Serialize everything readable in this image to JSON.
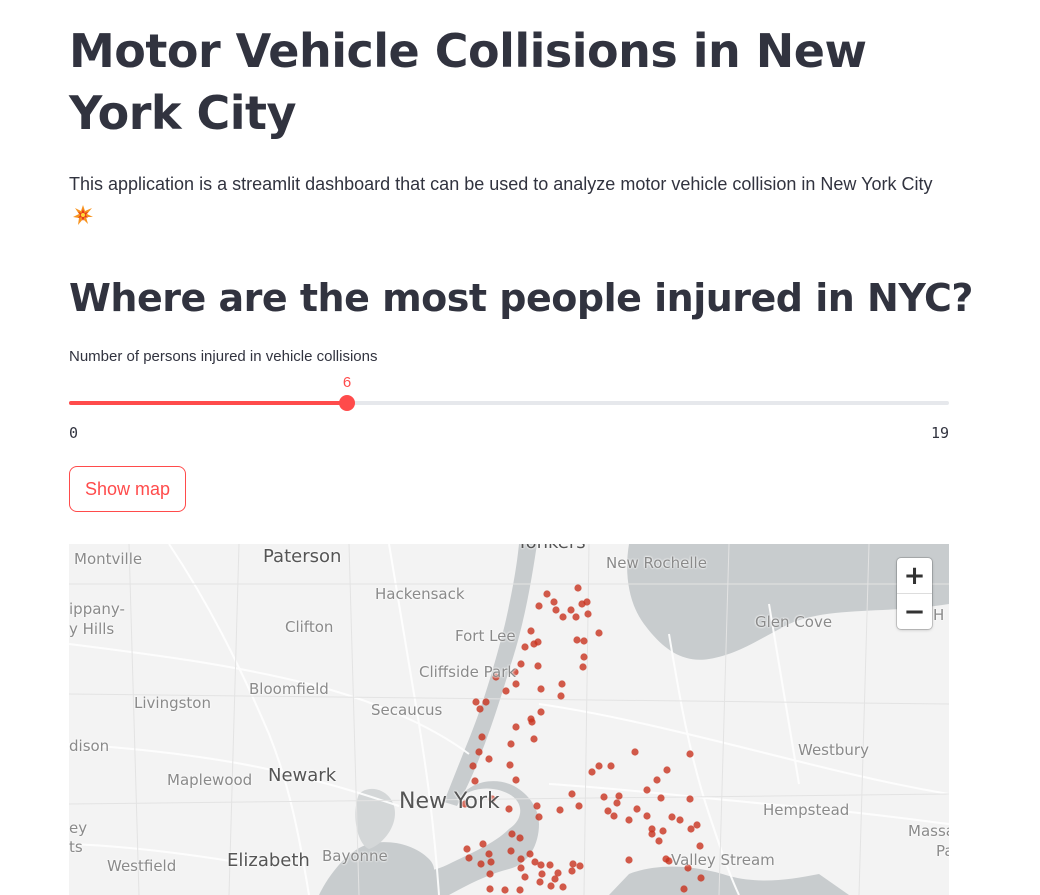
{
  "title": "Motor Vehicle Collisions in New York City",
  "intro": "This application is a streamlit dashboard that can be used to analyze motor vehicle collision in New York City",
  "section_heading": "Where are the most people injured in NYC?",
  "slider": {
    "label": "Number of persons injured in vehicle collisions",
    "min": 0,
    "max": 19,
    "value": 6,
    "min_label": "0",
    "max_label": "19",
    "value_label": "6"
  },
  "show_map_button": "Show map",
  "map": {
    "zoom_in": "+",
    "zoom_out": "−",
    "places": [
      {
        "name": "Montville",
        "size": "normal"
      },
      {
        "name": "Paterson",
        "size": "big"
      },
      {
        "name": "Yonkers",
        "size": "big"
      },
      {
        "name": "New Rochelle",
        "size": "normal"
      },
      {
        "name": "Hackensack",
        "size": "normal"
      },
      {
        "name": "ippany-",
        "size": "normal"
      },
      {
        "name": "y Hills",
        "size": "normal"
      },
      {
        "name": "Clifton",
        "size": "normal"
      },
      {
        "name": "Fort Lee",
        "size": "normal"
      },
      {
        "name": "Glen Cove",
        "size": "normal"
      },
      {
        "name": "Cliffside Park",
        "size": "normal"
      },
      {
        "name": "Bloomfield",
        "size": "normal"
      },
      {
        "name": "Livingston",
        "size": "normal"
      },
      {
        "name": "Secaucus",
        "size": "normal"
      },
      {
        "name": "dison",
        "size": "normal"
      },
      {
        "name": "Westbury",
        "size": "normal"
      },
      {
        "name": "Maplewood",
        "size": "normal"
      },
      {
        "name": "Newark",
        "size": "big"
      },
      {
        "name": "New York",
        "size": "huge"
      },
      {
        "name": "Hempstead",
        "size": "normal"
      },
      {
        "name": "ey",
        "size": "normal"
      },
      {
        "name": "ts",
        "size": "normal"
      },
      {
        "name": "Massa",
        "size": "normal"
      },
      {
        "name": "Pa",
        "size": "normal"
      },
      {
        "name": "Westfield",
        "size": "normal"
      },
      {
        "name": "Elizabeth",
        "size": "big"
      },
      {
        "name": "Bayonne",
        "size": "normal"
      },
      {
        "name": "Valley Stream",
        "size": "normal"
      },
      {
        "name": "H",
        "size": "normal"
      }
    ],
    "marker_color": "#c8321e"
  },
  "colors": {
    "accent": "#ff4b4b",
    "text": "#31333f"
  }
}
